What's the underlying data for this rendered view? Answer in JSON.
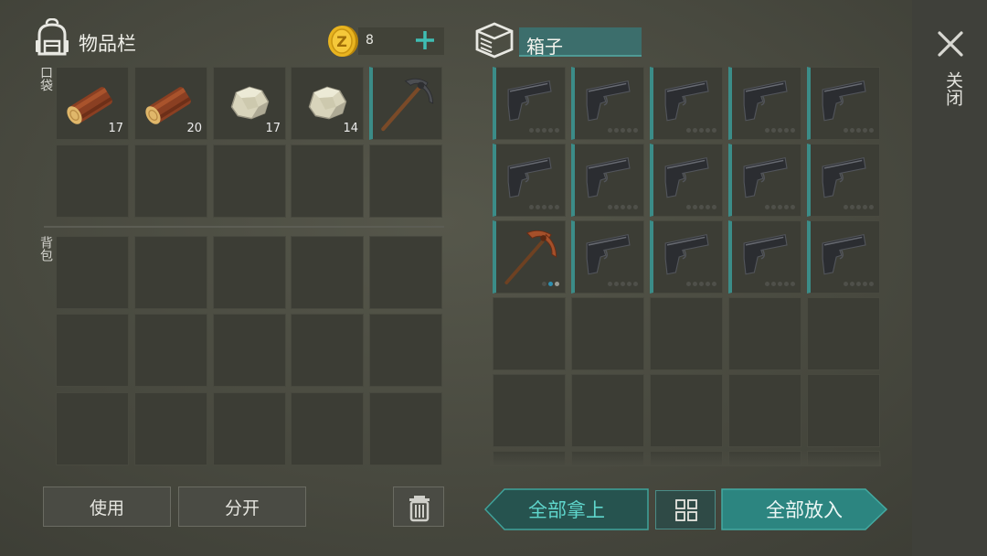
{
  "inventory": {
    "title": "物品栏",
    "coins": "8",
    "pocket_label": "口袋",
    "backpack_label": "背包",
    "pocket_slots": [
      {
        "item": "log",
        "qty": "17"
      },
      {
        "item": "log",
        "qty": "20"
      },
      {
        "item": "stone",
        "qty": "17"
      },
      {
        "item": "stone",
        "qty": "14"
      },
      {
        "item": "pickaxe",
        "qty": ""
      },
      {
        "item": "",
        "qty": ""
      },
      {
        "item": "",
        "qty": ""
      },
      {
        "item": "",
        "qty": ""
      },
      {
        "item": "",
        "qty": ""
      },
      {
        "item": "",
        "qty": ""
      }
    ]
  },
  "box": {
    "title": "箱子",
    "slots": [
      "pistol",
      "pistol",
      "pistol",
      "pistol",
      "pistol",
      "pistol",
      "pistol",
      "pistol",
      "pistol",
      "pistol",
      "copper-pickaxe",
      "pistol",
      "pistol",
      "pistol",
      "pistol"
    ]
  },
  "actions": {
    "use": "使用",
    "split": "分开",
    "take_all": "全部拿上",
    "put_all": "全部放入"
  },
  "close_label": "关闭",
  "colors": {
    "accent": "#3b8c88",
    "take_all_text": "#5fd6cc",
    "button_teal": "#2c8580"
  }
}
